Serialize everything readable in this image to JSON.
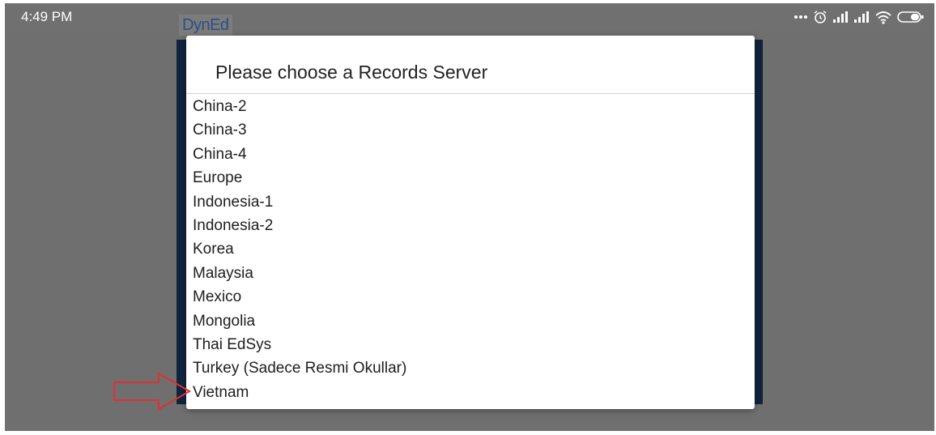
{
  "status_bar": {
    "time": "4:49 PM",
    "icons": [
      "more-dots-icon",
      "alarm-icon",
      "signal-icon",
      "signal-icon",
      "wifi-icon",
      "battery-icon"
    ]
  },
  "app": {
    "brand": "DynEd"
  },
  "dialog": {
    "title": "Please choose a Records Server",
    "servers": [
      "China-2",
      "China-3",
      "China-4",
      "Europe",
      "Indonesia-1",
      "Indonesia-2",
      "Korea",
      "Malaysia",
      "Mexico",
      "Mongolia",
      "Thai EdSys",
      "Turkey (Sadece Resmi Okullar)",
      "Vietnam"
    ]
  },
  "annotation": {
    "arrow_color": "#e03030",
    "arrow_target": "Vietnam"
  },
  "colors": {
    "overlay": "#6f6f6f",
    "dialog_bg": "#ffffff",
    "app_frame": "#11243d",
    "brand": "#2a4f86"
  }
}
